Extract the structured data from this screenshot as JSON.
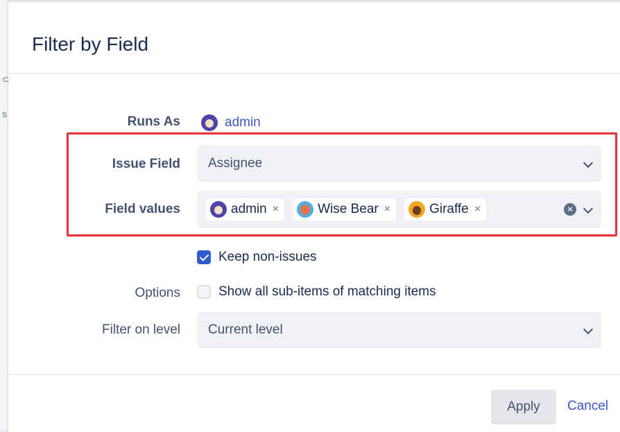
{
  "dialog": {
    "title": "Filter by Field"
  },
  "runs_as": {
    "label": "Runs As",
    "user": "admin"
  },
  "issue_field": {
    "label": "Issue Field",
    "value": "Assignee"
  },
  "field_values": {
    "label": "Field values",
    "chips": [
      {
        "label": "admin",
        "avatar": "admin"
      },
      {
        "label": "Wise Bear",
        "avatar": "bear"
      },
      {
        "label": "Giraffe",
        "avatar": "giraffe"
      }
    ],
    "remove_glyph": "×",
    "clear_glyph": "×"
  },
  "options": {
    "label": "Options",
    "keep_non_issues": {
      "label": "Keep non-issues",
      "checked": true
    },
    "show_sub_items": {
      "label": "Show all sub-items of matching items",
      "checked": false
    }
  },
  "filter_level": {
    "label": "Filter on level",
    "value": "Current level"
  },
  "footer": {
    "apply": "Apply",
    "cancel": "Cancel"
  },
  "colors": {
    "link": "#3c57c9",
    "checkbox": "#2e5ccf",
    "highlight": "#e5353a"
  }
}
